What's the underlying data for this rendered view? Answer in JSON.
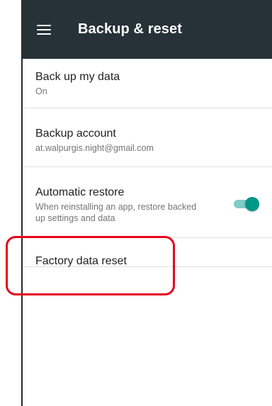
{
  "app_bar": {
    "title": "Backup & reset",
    "menu_icon": "hamburger-menu-icon",
    "background_color": "#263238"
  },
  "settings": [
    {
      "title": "Back up my data",
      "subtitle": "On"
    },
    {
      "title": "Backup account",
      "subtitle": "at.walpurgis.night@gmail.com"
    },
    {
      "title": "Automatic restore",
      "subtitle": "When reinstalling an app, restore backed up settings and data",
      "toggle_on": true
    },
    {
      "title": "Factory data reset"
    }
  ],
  "toggle_color": "#009688",
  "highlight_color": "#e8001c"
}
